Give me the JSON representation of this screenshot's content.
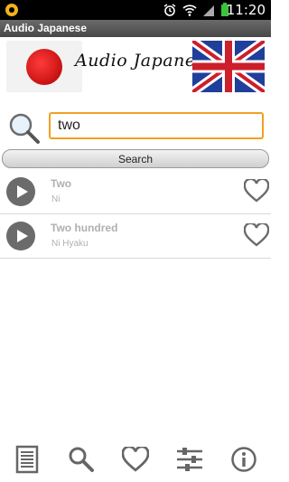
{
  "status_bar": {
    "time": "11:20"
  },
  "app": {
    "title": "Audio Japanese"
  },
  "banner": {
    "title": "Audio Japanese"
  },
  "search": {
    "value": "two",
    "button_label": "Search"
  },
  "results": [
    {
      "english": "Two",
      "japanese": "Ni"
    },
    {
      "english": "Two hundred",
      "japanese": "Ni Hyaku"
    }
  ],
  "colors": {
    "accent": "#f0a020",
    "title_bar": "#595959",
    "muted_text": "#b0b0b0"
  },
  "nav": [
    "list-icon",
    "search-icon",
    "heart-icon",
    "settings-sliders-icon",
    "info-icon"
  ]
}
